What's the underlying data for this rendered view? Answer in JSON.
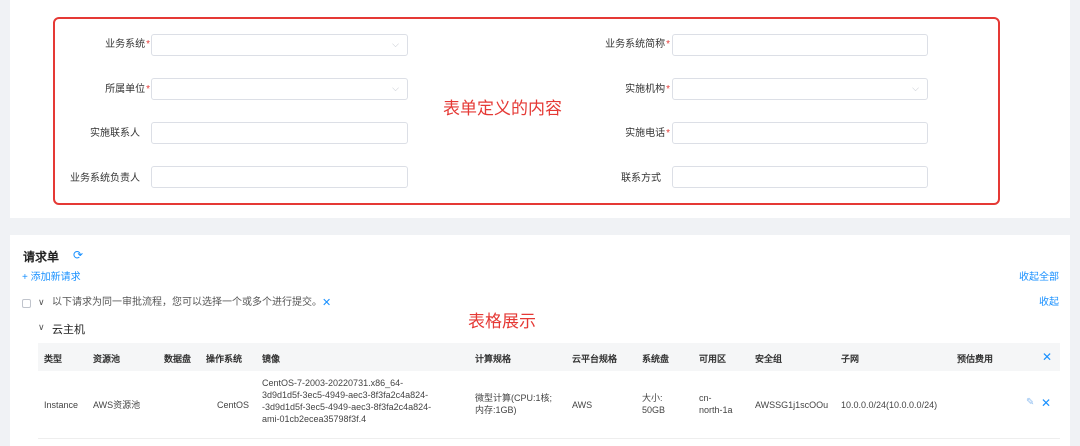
{
  "form": {
    "business_system": "业务系统",
    "business_system_abbr": "业务系统简称",
    "unit": "所属单位",
    "org": "实施机构",
    "contact": "实施联系人",
    "phone": "实施电话",
    "owner": "业务系统负责人",
    "contact_method": "联系方式",
    "required_mark": "*"
  },
  "annotations": {
    "form": "表单定义的内容",
    "table": "表格展示"
  },
  "request": {
    "title": "请求单",
    "add": "+ 添加新请求",
    "collapse_all": "收起全部",
    "group_note": "以下请求为同一审批流程，您可以选择一个或多个进行提交。",
    "collapse": "收起",
    "category": "云主机"
  },
  "table": {
    "headers": [
      "类型",
      "资源池",
      "数据盘",
      "操作系统",
      "镜像",
      "计算规格",
      "云平台规格",
      "系统盘",
      "可用区",
      "安全组",
      "子网",
      "预估费用"
    ],
    "row": {
      "type": "Instance",
      "pool": "AWS资源池",
      "data_disk": "",
      "os": "CentOS",
      "image": "CentOS-7-2003-20220731.x86_64-3d9d1d5f-3ec5-4949-aec3-8f3fa2c4a824--3d9d1d5f-3ec5-4949-aec3-8f3fa2c4a824-ami-01cb2ecea35798f3f.4",
      "image_lines": [
        "CentOS-7-2003-20220731.x86_64-",
        "3d9d1d5f-3ec5-4949-aec3-8f3fa2c4a824-",
        "-3d9d1d5f-3ec5-4949-aec3-8f3fa2c4a824-",
        "ami-01cb2ecea35798f3f.4"
      ],
      "compute_lines": [
        "微型计算(CPU:1核;",
        "内存:1GB)"
      ],
      "platform": "AWS",
      "sysdisk_lines": [
        "大小:",
        "50GB"
      ],
      "zone_lines": [
        "cn-",
        "north-1a"
      ],
      "sg": "AWSSG1j1scOOu",
      "subnet": "10.0.0.0/24(10.0.0.0/24)",
      "cost": ""
    }
  },
  "icons": {
    "chevron": "⌵",
    "refresh": "⟳",
    "close": "✕",
    "caret_down": "∨",
    "edit": "✎"
  },
  "colors": {
    "accent": "#1890ff",
    "annotation": "#e53935"
  }
}
